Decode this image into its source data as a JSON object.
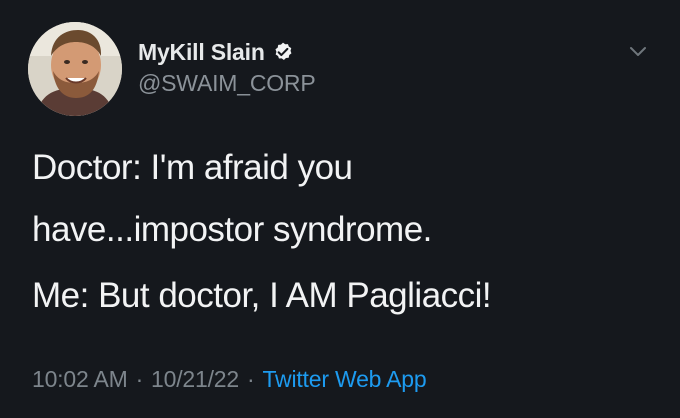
{
  "user": {
    "display_name": "MyKill Slain",
    "handle": "@SWAIM_CORP",
    "verified": true
  },
  "tweet": {
    "lines": [
      "Doctor: I'm afraid you",
      "have...impostor syndrome.",
      "Me: But doctor, I AM Pagliacci!"
    ]
  },
  "meta": {
    "time": "10:02 AM",
    "separator_1": "·",
    "date": "10/21/22",
    "separator_2": "·",
    "source": "Twitter Web App"
  },
  "icons": {
    "verified": "verified-badge-icon",
    "menu": "chevron-down-icon"
  },
  "colors": {
    "background": "#15181d",
    "text": "#e7e9ea",
    "muted": "#7d858c",
    "link": "#1d9bf0"
  }
}
